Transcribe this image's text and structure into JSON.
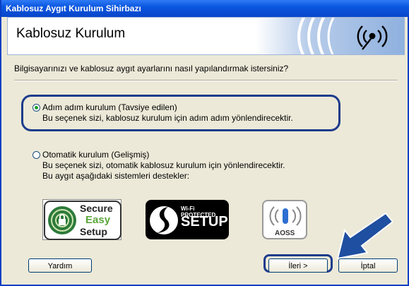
{
  "window": {
    "title": "Kablosuz Aygıt Kurulum Sihirbazı"
  },
  "header": {
    "title": "Kablosuz Kurulum"
  },
  "question": "Bilgisayarınızı ve kablosuz aygıt ayarlarını nasıl yapılandırmak istersiniz?",
  "options": [
    {
      "label": "Adım adım kurulum (Tavsiye edilen)",
      "description": "Bu seçenek sizi, kablosuz kurulum için adım adım yönlendirecektir.",
      "selected": true
    },
    {
      "label": "Otomatik kurulum (Gelişmiş)",
      "description": "Bu seçenek sizi, otomatik kablosuz kurulum için yönlendirecektir.",
      "description2": "Bu aygıt aşağıdaki sistemleri destekler:",
      "selected": false
    }
  ],
  "logos": {
    "ses": [
      "Secure",
      "Easy",
      "Setup"
    ],
    "wps_small": "Wi-Fi PROTECTED",
    "wps_big": "SETUP",
    "aoss": "AOSS"
  },
  "buttons": {
    "help": "Yardım",
    "next": "İleri >",
    "cancel": "İptal"
  },
  "colors": {
    "title_bar": "#0a56e0",
    "highlight": "#1c3c8c",
    "arrow": "#1f4fa0"
  }
}
